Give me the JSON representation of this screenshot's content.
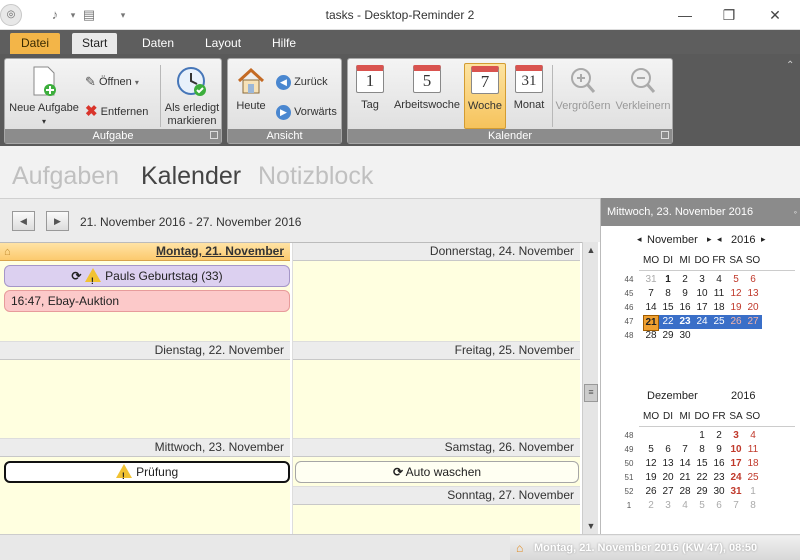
{
  "window": {
    "title": "tasks - Desktop-Reminder 2"
  },
  "ribbon_tabs": [
    "Datei",
    "Start",
    "Daten",
    "Layout",
    "Hilfe"
  ],
  "ribbon": {
    "aufgabe": {
      "caption": "Aufgabe",
      "new_task": "Neue Aufgabe",
      "open": "Öffnen",
      "remove": "Entfernen",
      "mark_done": "Als erledigt markieren"
    },
    "ansicht": {
      "caption": "Ansicht",
      "today": "Heute",
      "back": "Zurück",
      "forward": "Vorwärts"
    },
    "kalender": {
      "caption": "Kalender",
      "day": "Tag",
      "day_num": "1",
      "workweek": "Arbeitswoche",
      "workweek_num": "5",
      "week": "Woche",
      "week_num": "7",
      "month": "Monat",
      "month_num": "31",
      "zoom_in": "Vergrößern",
      "zoom_out": "Verkleinern"
    }
  },
  "modules": [
    "Aufgaben",
    "Kalender",
    "Notizblock"
  ],
  "range": "21. November 2016 - 27. November 2016",
  "days": {
    "mon": "Montag, 21. November",
    "tue": "Dienstag, 22. November",
    "wed": "Mittwoch, 23. November",
    "thu": "Donnerstag, 24. November",
    "fri": "Freitag, 25. November",
    "sat": "Samstag, 26. November",
    "sun": "Sonntag, 27. November"
  },
  "events": {
    "birthday": "Pauls Geburtstag (33)",
    "ebay": "16:47, Ebay-Auktion",
    "exam": "Prüfung",
    "carwash": "Auto waschen"
  },
  "right_pane": {
    "header": "Mittwoch, 23. November 2016"
  },
  "mini_cal": {
    "weekdays": [
      "MO",
      "DI",
      "MI",
      "DO",
      "FR",
      "SA",
      "SO"
    ],
    "nov": {
      "month": "November",
      "year": "2016",
      "rows": [
        {
          "wk": "44",
          "d": [
            "31",
            "1",
            "2",
            "3",
            "4",
            "5",
            "6"
          ]
        },
        {
          "wk": "45",
          "d": [
            "7",
            "8",
            "9",
            "10",
            "11",
            "12",
            "13"
          ]
        },
        {
          "wk": "46",
          "d": [
            "14",
            "15",
            "16",
            "17",
            "18",
            "19",
            "20"
          ]
        },
        {
          "wk": "47",
          "d": [
            "21",
            "22",
            "23",
            "24",
            "25",
            "26",
            "27"
          ]
        },
        {
          "wk": "48",
          "d": [
            "28",
            "29",
            "30",
            "",
            "",
            "",
            ""
          ]
        }
      ]
    },
    "dec": {
      "month": "Dezember",
      "year": "2016",
      "rows": [
        {
          "wk": "48",
          "d": [
            "",
            "",
            "",
            "1",
            "2",
            "3",
            "4"
          ]
        },
        {
          "wk": "49",
          "d": [
            "5",
            "6",
            "7",
            "8",
            "9",
            "10",
            "11"
          ]
        },
        {
          "wk": "50",
          "d": [
            "12",
            "13",
            "14",
            "15",
            "16",
            "17",
            "18"
          ]
        },
        {
          "wk": "51",
          "d": [
            "19",
            "20",
            "21",
            "22",
            "23",
            "24",
            "25"
          ]
        },
        {
          "wk": "52",
          "d": [
            "26",
            "27",
            "28",
            "29",
            "30",
            "31",
            "1"
          ]
        },
        {
          "wk": "1",
          "d": [
            "2",
            "3",
            "4",
            "5",
            "6",
            "7",
            "8"
          ]
        }
      ]
    }
  },
  "status": "Montag, 21. November 2016 (KW 47), 08:50",
  "colors": {
    "accent": "#f3b548",
    "today_header": "#fcca6e",
    "selected_week": "#3a6fc8",
    "weekend": "#c0392b",
    "day_bg": "#ffffe0"
  }
}
